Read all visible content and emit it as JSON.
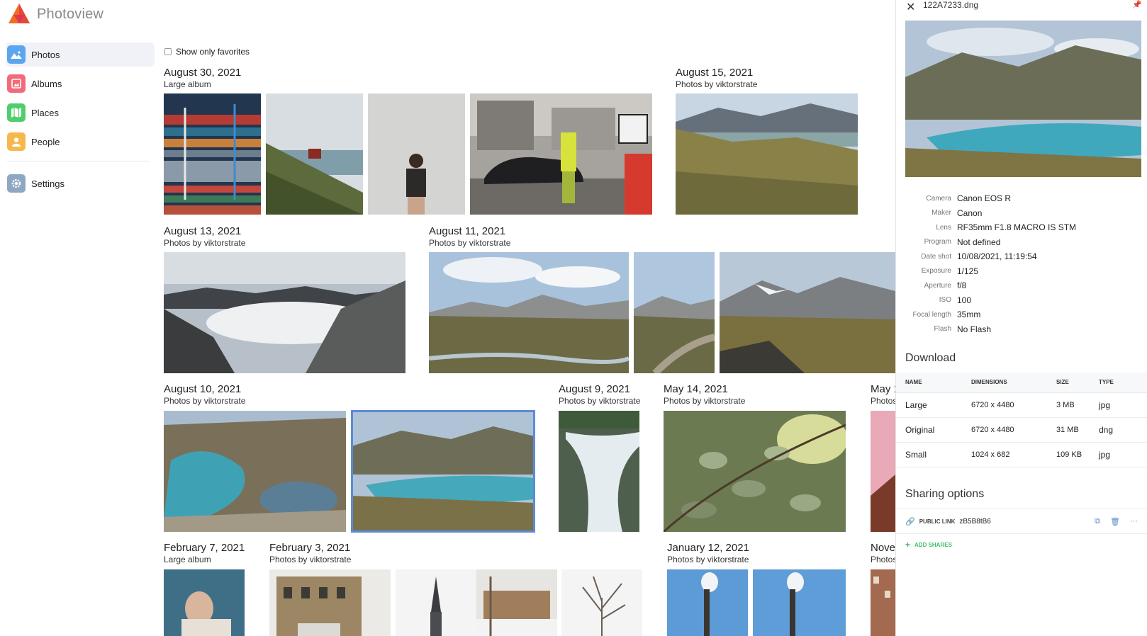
{
  "app": {
    "name": "Photoview"
  },
  "sidebar": {
    "items": [
      {
        "label": "Photos",
        "icon": "photos-icon",
        "color": "#5aa7f0"
      },
      {
        "label": "Albums",
        "icon": "albums-icon",
        "color": "#f26b7a"
      },
      {
        "label": "Places",
        "icon": "places-icon",
        "color": "#4fcf6c"
      },
      {
        "label": "People",
        "icon": "people-icon",
        "color": "#f7b84b"
      }
    ],
    "settings": {
      "label": "Settings",
      "icon": "gear-icon",
      "color": "#8fa7c2"
    }
  },
  "filter": {
    "label": "Show only favorites"
  },
  "groups": [
    {
      "date": "August 30, 2021",
      "subtitle": "Large album"
    },
    {
      "date": "August 15, 2021",
      "subtitle": "Photos by viktorstrate"
    },
    {
      "date": "August 13, 2021",
      "subtitle": "Photos by viktorstrate"
    },
    {
      "date": "August 11, 2021",
      "subtitle": "Photos by viktorstrate"
    },
    {
      "date": "August 10, 2021",
      "subtitle": "Photos by viktorstrate"
    },
    {
      "date": "August 9, 2021",
      "subtitle": "Photos by viktorstrate"
    },
    {
      "date": "May 14, 2021",
      "subtitle": "Photos by viktorstrate"
    },
    {
      "date": "May 1",
      "subtitle": "Photos"
    },
    {
      "date": "February 7, 2021",
      "subtitle": "Large album"
    },
    {
      "date": "February 3, 2021",
      "subtitle": "Photos by viktorstrate"
    },
    {
      "date": "January 12, 2021",
      "subtitle": "Photos by viktorstrate"
    },
    {
      "date": "Nove",
      "subtitle": "Photos"
    }
  ],
  "detail": {
    "filename": "122A7233.dng",
    "exif": [
      {
        "key": "Camera",
        "value": "Canon EOS R"
      },
      {
        "key": "Maker",
        "value": "Canon"
      },
      {
        "key": "Lens",
        "value": "RF35mm F1.8 MACRO IS STM"
      },
      {
        "key": "Program",
        "value": "Not defined"
      },
      {
        "key": "Date shot",
        "value": "10/08/2021, 11:19:54"
      },
      {
        "key": "Exposure",
        "value": "1/125"
      },
      {
        "key": "Aperture",
        "value": "f/8"
      },
      {
        "key": "ISO",
        "value": "100"
      },
      {
        "key": "Focal length",
        "value": "35mm"
      },
      {
        "key": "Flash",
        "value": "No Flash"
      }
    ],
    "download": {
      "heading": "Download",
      "columns": [
        "NAME",
        "DIMENSIONS",
        "SIZE",
        "TYPE"
      ],
      "rows": [
        {
          "name": "Large",
          "dimensions": "6720 x 4480",
          "size": "3 MB",
          "type": "jpg"
        },
        {
          "name": "Original",
          "dimensions": "6720 x 4480",
          "size": "31 MB",
          "type": "dng"
        },
        {
          "name": "Small",
          "dimensions": "1024 x 682",
          "size": "109 KB",
          "type": "jpg"
        }
      ]
    },
    "sharing": {
      "heading": "Sharing options",
      "link_label": "PUBLIC LINK",
      "link_code": "zB5B8tB6",
      "add_label": "ADD SHARES"
    }
  }
}
